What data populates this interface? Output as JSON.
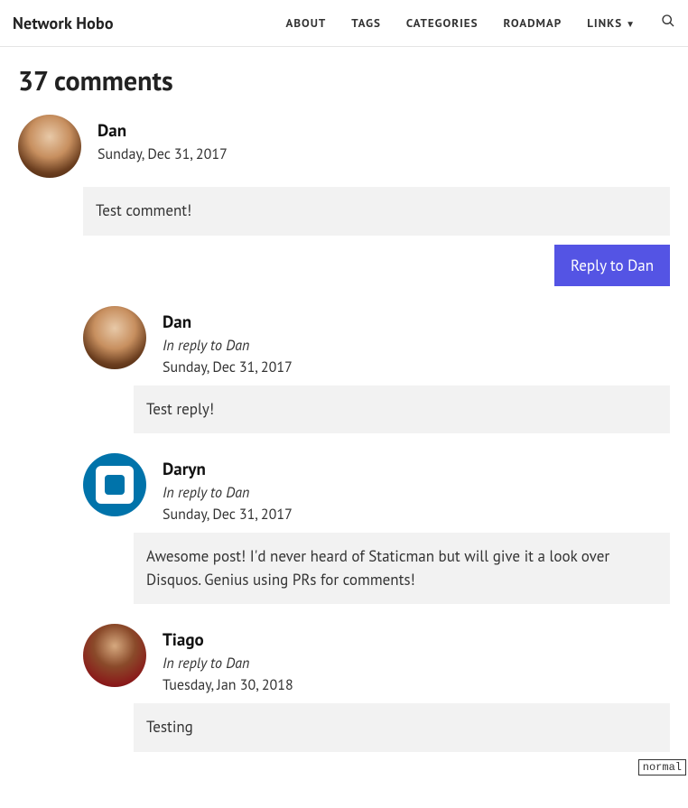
{
  "header": {
    "brand": "Network Hobo",
    "nav": {
      "about": "ABOUT",
      "tags": "TAGS",
      "categories": "CATEGORIES",
      "roadmap": "ROADMAP",
      "links": "LINKS"
    }
  },
  "comments_title": "37 comments",
  "top_comment": {
    "author": "Dan",
    "date": "Sunday, Dec 31, 2017",
    "body": "Test comment!",
    "reply_label": "Reply to Dan"
  },
  "replies": [
    {
      "author": "Dan",
      "in_reply_prefix": "In reply to ",
      "in_reply_to": "Dan",
      "date": "Sunday, Dec 31, 2017",
      "body": "Test reply!",
      "avatar": "dan"
    },
    {
      "author": "Daryn",
      "in_reply_prefix": "In reply to ",
      "in_reply_to": "Dan",
      "date": "Sunday, Dec 31, 2017",
      "body": "Awesome post! I'd never heard of Staticman but will give it a look over Disquos. Genius using PRs for comments!",
      "avatar": "gravatar"
    },
    {
      "author": "Tiago",
      "in_reply_prefix": "In reply to ",
      "in_reply_to": "Dan",
      "date": "Tuesday, Jan 30, 2018",
      "body": "Testing",
      "avatar": "tiago"
    }
  ],
  "badge": "normal"
}
